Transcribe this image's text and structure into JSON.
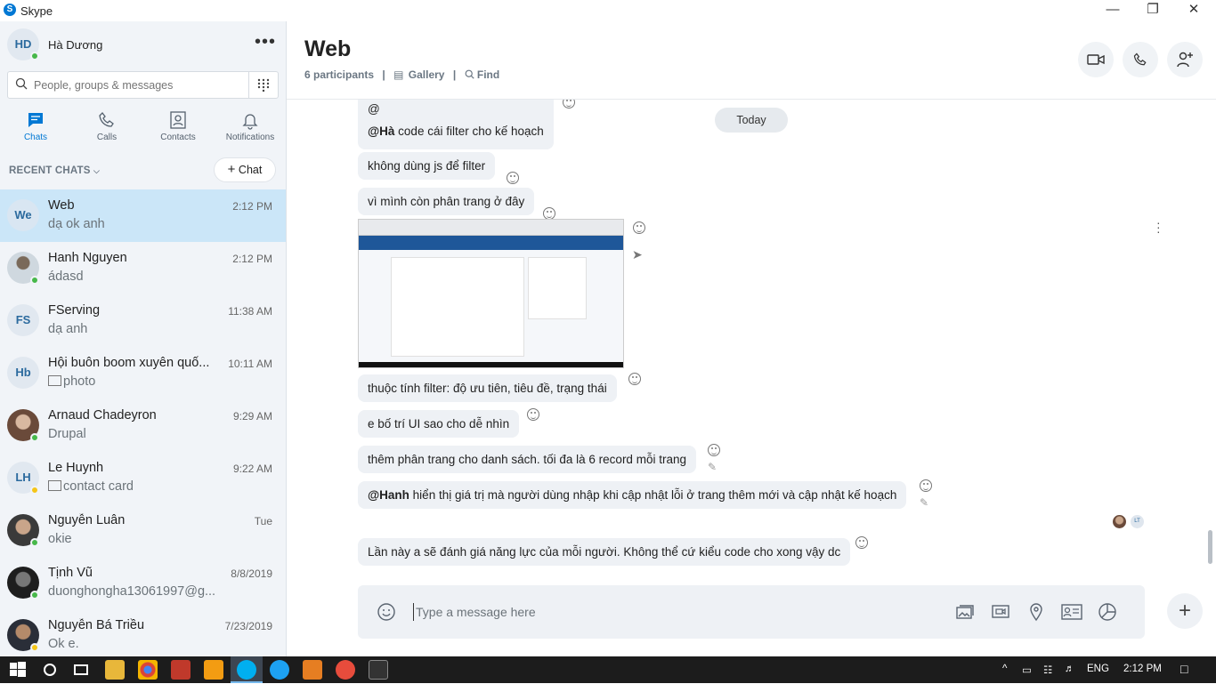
{
  "window": {
    "title": "Skype"
  },
  "profile": {
    "initials": "HD",
    "name": "Hà Dương"
  },
  "search": {
    "placeholder": "People, groups & messages"
  },
  "nav": {
    "chats": "Chats",
    "calls": "Calls",
    "contacts": "Contacts",
    "notifications": "Notifications"
  },
  "recent": {
    "header": "RECENT CHATS",
    "new_chat": "Chat"
  },
  "chats": [
    {
      "initials": "We",
      "name": "Web",
      "time": "2:12 PM",
      "preview": "dạ ok anh",
      "selected": true
    },
    {
      "initials": "",
      "name": "Hanh Nguyen",
      "time": "2:12 PM",
      "preview": "ádasd",
      "presence": "online"
    },
    {
      "initials": "FS",
      "name": "FServing",
      "time": "11:38 AM",
      "preview": "dạ anh"
    },
    {
      "initials": "Hb",
      "name": "Hội buôn boom xuyên quố...",
      "time": "10:11 AM",
      "preview": "photo",
      "preview_icon": "image-icon"
    },
    {
      "initials": "",
      "name": "Arnaud Chadeyron",
      "time": "9:29 AM",
      "preview": "Drupal",
      "presence": "online"
    },
    {
      "initials": "LH",
      "name": "Le Huynh",
      "time": "9:22 AM",
      "preview": "contact card",
      "preview_icon": "contact-card-icon",
      "presence": "away"
    },
    {
      "initials": "",
      "name": "Nguyễn Luân",
      "time": "Tue",
      "preview": "okie",
      "presence": "online"
    },
    {
      "initials": "",
      "name": "Tịnh Vũ",
      "time": "8/8/2019",
      "preview": "duonghongha13061997@g...",
      "presence": "online"
    },
    {
      "initials": "",
      "name": "Nguyễn Bá Triều",
      "time": "7/23/2019",
      "preview": "Ok e.",
      "presence": "away"
    }
  ],
  "conversation": {
    "title": "Web",
    "participants": "6 participants",
    "gallery": "Gallery",
    "find": "Find",
    "today": "Today",
    "messages": {
      "m1_line1": "@",
      "m1_mention": "@Hà",
      "m1_text": " code cái filter cho kế hoạch",
      "m2": "không dùng js để filter",
      "m3": "vì mình còn phân trang ở đây",
      "m4": "thuộc tính filter: độ ưu tiên, tiêu đề, trạng thái",
      "m5": "e bố trí UI sao cho dễ nhìn",
      "m6": "thêm phân trang cho danh sách. tối đa là 6 record mỗi trang",
      "m7_mention": "@Hanh",
      "m7_text": " hiển thị giá trị mà người dùng nhập khi cập nhật lỗi ở trang thêm mới và cập nhật kế hoạch",
      "m8": "Lần này a sẽ  đánh giá năng lực của mỗi người. Không thể cứ kiểu code cho xong vậy dc"
    },
    "read_receipt_initials": "LT"
  },
  "composer": {
    "placeholder": "Type a message here"
  },
  "taskbar": {
    "language": "ENG",
    "time": "2:12 PM"
  },
  "colors": {
    "accent": "#0078d4",
    "selected": "#cbe6f8",
    "online": "#47b84a",
    "away": "#f5c518"
  }
}
